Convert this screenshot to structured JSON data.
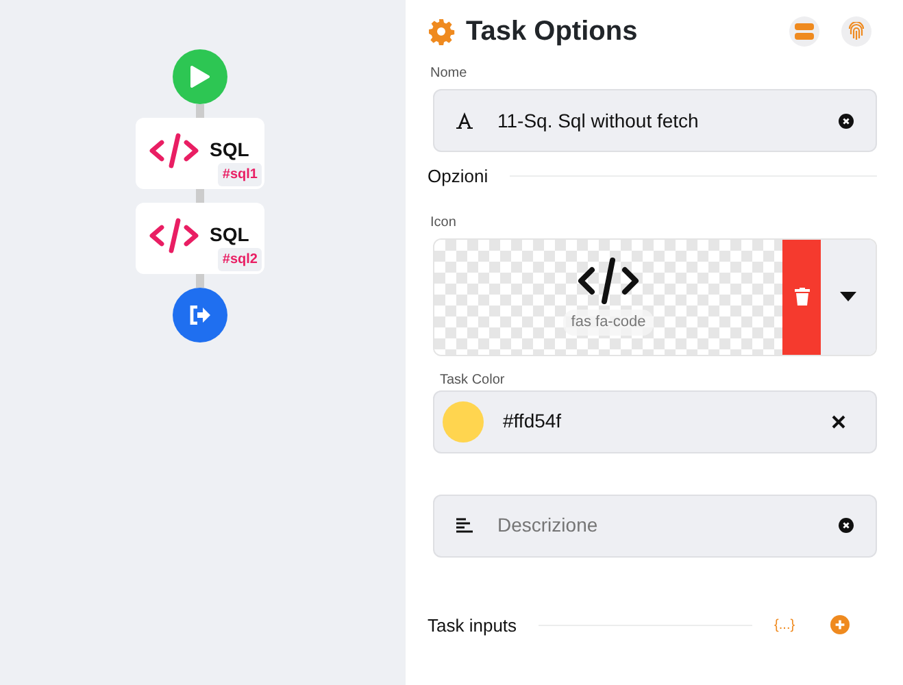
{
  "flow": {
    "nodes": [
      {
        "kind": "start"
      },
      {
        "kind": "task",
        "label": "SQL",
        "tag": "#sql1"
      },
      {
        "kind": "task",
        "label": "SQL",
        "tag": "#sql2"
      },
      {
        "kind": "end"
      }
    ]
  },
  "panel": {
    "title": "Task Options",
    "name_field": {
      "label": "Nome",
      "value": "11-Sq. Sql without fetch"
    },
    "options_section": "Opzioni",
    "icon_field": {
      "label": "Icon",
      "value": "fas fa-code"
    },
    "color_field": {
      "label": "Task Color",
      "value": "#ffd54f",
      "color": "#ffd54f"
    },
    "description_field": {
      "placeholder": "Descrizione"
    },
    "inputs_section": {
      "label": "Task inputs",
      "json_button": "{...}"
    }
  }
}
